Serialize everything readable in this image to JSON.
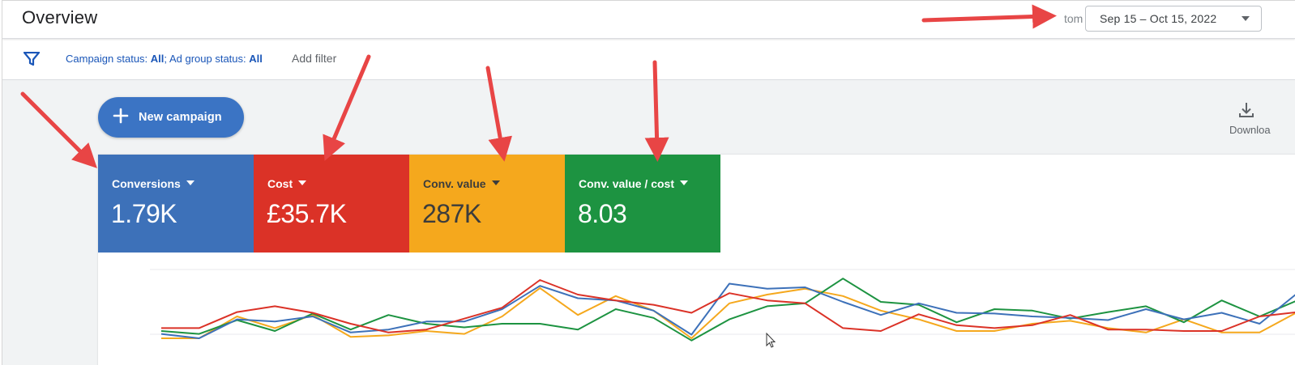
{
  "header": {
    "title": "Overview",
    "range_prefix": "tom",
    "date_range": "Sep 15 – Oct 15, 2022"
  },
  "filters": {
    "campaign_status_label": "Campaign status:",
    "campaign_status_value": "All",
    "separator": ";",
    "ad_group_status_label": "Ad group status:",
    "ad_group_status_value": "All",
    "add_filter": "Add filter"
  },
  "actions": {
    "new_campaign": "New campaign",
    "download": "Downloa"
  },
  "metrics": [
    {
      "name": "Conversions",
      "value": "1.79K",
      "color": "#3d71b9"
    },
    {
      "name": "Cost",
      "value": "£35.7K",
      "color": "#db3227"
    },
    {
      "name": "Conv. value",
      "value": "287K",
      "color": "#f5a81d"
    },
    {
      "name": "Conv. value / cost",
      "value": "8.03",
      "color": "#1d9341"
    }
  ],
  "colors": {
    "accent": "#3b74c4",
    "link": "#1a56b8",
    "annotation_arrow": "#e84545"
  },
  "chart_data": {
    "type": "line",
    "x": [
      1,
      2,
      3,
      4,
      5,
      6,
      7,
      8,
      9,
      10,
      11,
      12,
      13,
      14,
      15,
      16,
      17,
      18,
      19,
      20,
      21,
      22,
      23,
      24,
      25,
      26,
      27,
      28,
      29,
      30,
      31
    ],
    "series": [
      {
        "color": "#3d71b9",
        "values": [
          6,
          0,
          26,
          23,
          30,
          8,
          12,
          23,
          23,
          40,
          72,
          55,
          52,
          38,
          5,
          75,
          68,
          70,
          50,
          32,
          48,
          35,
          34,
          30,
          28,
          25,
          40,
          26,
          35,
          20,
          62
        ]
      },
      {
        "color": "#db3227",
        "values": [
          14,
          14,
          36,
          44,
          35,
          20,
          8,
          12,
          27,
          42,
          80,
          60,
          52,
          46,
          35,
          62,
          52,
          48,
          14,
          10,
          33,
          18,
          14,
          18,
          32,
          12,
          12,
          10,
          10,
          30,
          36
        ]
      },
      {
        "color": "#f5a81d",
        "values": [
          0,
          0,
          30,
          14,
          32,
          2,
          4,
          10,
          6,
          30,
          69,
          32,
          58,
          38,
          0,
          48,
          60,
          68,
          58,
          38,
          26,
          10,
          10,
          20,
          24,
          14,
          8,
          26,
          8,
          8,
          36
        ]
      },
      {
        "color": "#1d9341",
        "values": [
          10,
          6,
          25,
          10,
          34,
          12,
          32,
          20,
          15,
          20,
          20,
          12,
          40,
          28,
          -3,
          26,
          44,
          48,
          82,
          50,
          46,
          22,
          40,
          38,
          27,
          36,
          44,
          22,
          52,
          30,
          52
        ]
      }
    ]
  }
}
